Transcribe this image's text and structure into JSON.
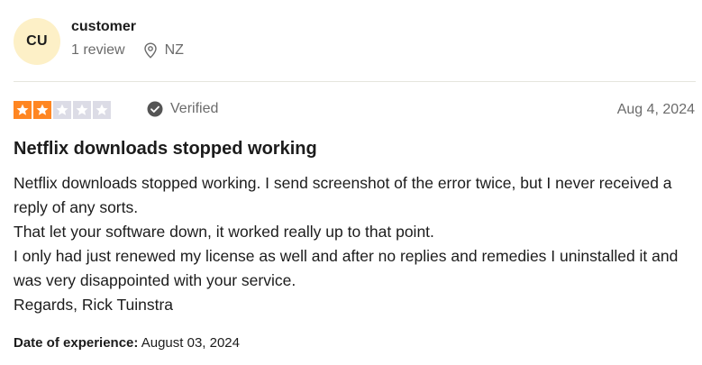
{
  "reviewer": {
    "initials": "CU",
    "avatar_color": "#fdf0c7",
    "name": "customer",
    "review_count": "1 review",
    "location_icon": "location-pin-icon",
    "country": "NZ"
  },
  "review": {
    "rating": 2,
    "max_rating": 5,
    "star_filled_color": "#ff8622",
    "star_empty_color": "#dcdce6",
    "verified_icon": "check-circle-icon",
    "verified_label": "Verified",
    "date": "Aug 4, 2024",
    "title": "Netflix downloads stopped working",
    "body": [
      "Netflix downloads stopped working. I send screenshot of the error twice, but I never received a reply of any sorts.",
      "That let your software down, it worked really up to that point.",
      "I only had just renewed my license as well and after no replies and remedies I uninstalled it and was very disappointed with your service.",
      "Regards, Rick Tuinstra"
    ],
    "experience_label": "Date of experience:",
    "experience_date": "August 03, 2024"
  }
}
